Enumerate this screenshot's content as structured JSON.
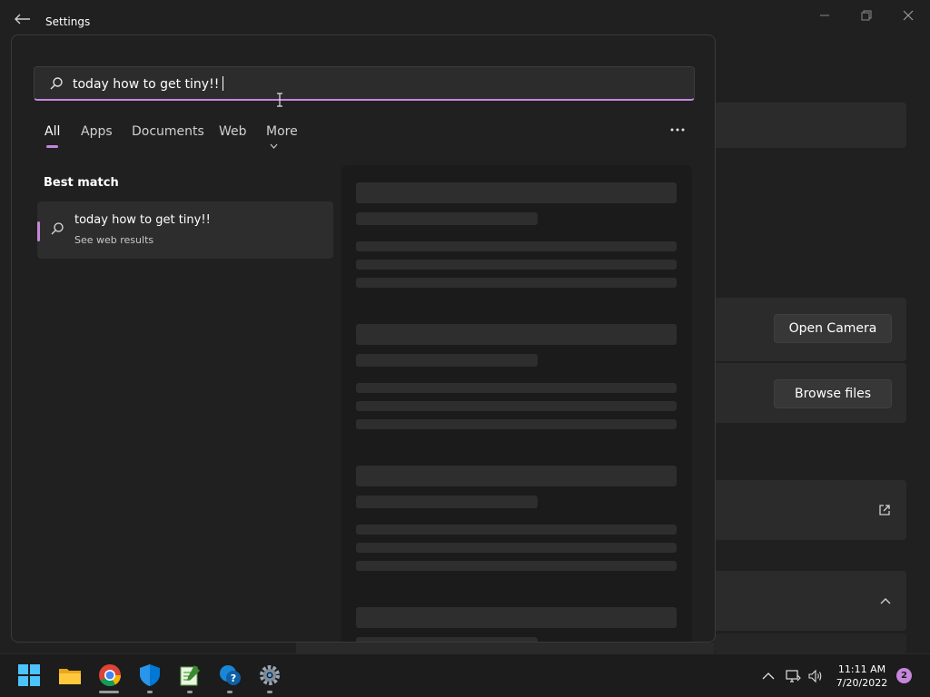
{
  "window": {
    "title": "Settings",
    "buttons": {
      "open_camera": "Open Camera",
      "browse_files": "Browse files"
    }
  },
  "search": {
    "query": "today how to get tiny!!",
    "tabs": [
      {
        "label": "All",
        "active": true
      },
      {
        "label": "Apps",
        "active": false
      },
      {
        "label": "Documents",
        "active": false
      },
      {
        "label": "Web",
        "active": false
      },
      {
        "label": "More",
        "active": false
      }
    ],
    "best_match_label": "Best match",
    "best_match": {
      "title": "today how to get tiny!!",
      "subtitle": "See web results"
    },
    "accent_color": "#c686dc"
  },
  "taskbar": {
    "apps": [
      "start-icon",
      "file-explorer-icon",
      "chrome-icon",
      "windows-security-icon",
      "notepad-icon",
      "get-help-icon",
      "settings-icon"
    ],
    "clock": {
      "time": "11:11 AM",
      "date": "7/20/2022"
    },
    "notification_count": "2"
  }
}
